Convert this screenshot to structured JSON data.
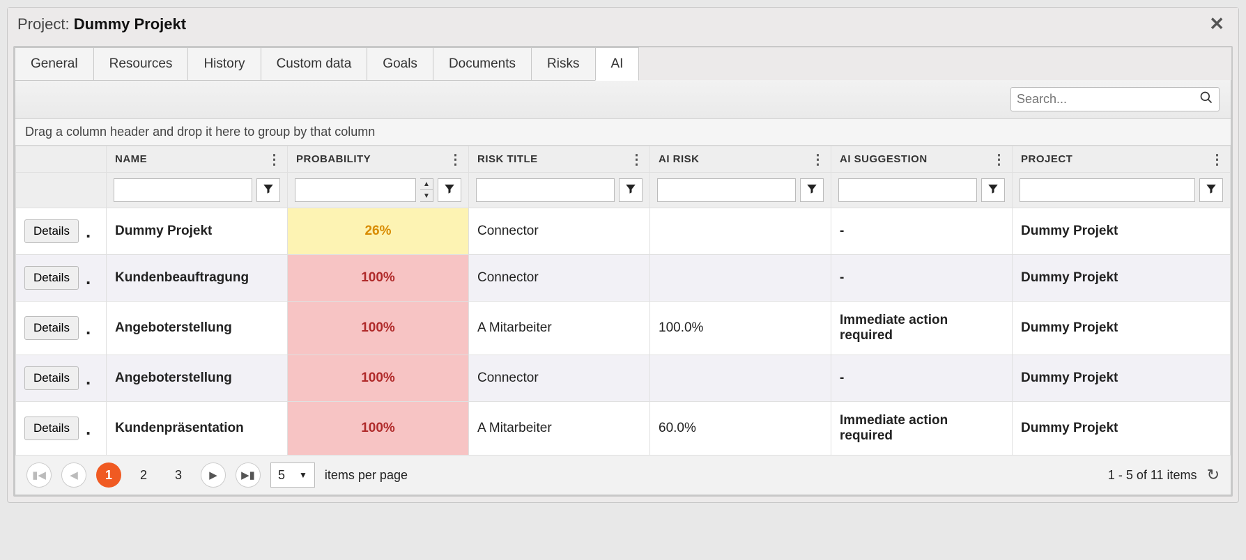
{
  "header": {
    "project_prefix": "Project: ",
    "project_name": "Dummy Projekt",
    "close_glyph": "✕"
  },
  "tabs": [
    {
      "label": "General"
    },
    {
      "label": "Resources"
    },
    {
      "label": "History"
    },
    {
      "label": "Custom data"
    },
    {
      "label": "Goals"
    },
    {
      "label": "Documents"
    },
    {
      "label": "Risks"
    },
    {
      "label": "AI",
      "active": true
    }
  ],
  "search": {
    "placeholder": "Search..."
  },
  "group_hint": "Drag a column header and drop it here to group by that column",
  "columns": [
    {
      "label": ""
    },
    {
      "label": "NAME"
    },
    {
      "label": "PROBABILITY"
    },
    {
      "label": "RISK TITLE"
    },
    {
      "label": "AI RISK"
    },
    {
      "label": "AI SUGGESTION"
    },
    {
      "label": "PROJECT"
    }
  ],
  "details_label": "Details",
  "rows": [
    {
      "name": "Dummy Projekt",
      "probability": "26%",
      "prob_style": "warn",
      "risk_title": "Connector",
      "ai_risk": "",
      "ai_suggestion": "-",
      "project": "Dummy Projekt"
    },
    {
      "name": "Kundenbeauftragung",
      "probability": "100%",
      "prob_style": "danger",
      "risk_title": "Connector",
      "ai_risk": "",
      "ai_suggestion": "-",
      "project": "Dummy Projekt"
    },
    {
      "name": "Angeboterstellung",
      "probability": "100%",
      "prob_style": "danger",
      "risk_title": "A Mitarbeiter",
      "ai_risk": "100.0%",
      "ai_suggestion": "Immediate action required",
      "project": "Dummy Projekt"
    },
    {
      "name": "Angeboterstellung",
      "probability": "100%",
      "prob_style": "danger",
      "risk_title": "Connector",
      "ai_risk": "",
      "ai_suggestion": "-",
      "project": "Dummy Projekt"
    },
    {
      "name": "Kundenpräsentation",
      "probability": "100%",
      "prob_style": "danger",
      "risk_title": "A Mitarbeiter",
      "ai_risk": "60.0%",
      "ai_suggestion": "Immediate action required",
      "project": "Dummy Projekt"
    }
  ],
  "pager": {
    "pages": [
      "1",
      "2",
      "3"
    ],
    "current": "1",
    "page_size": "5",
    "items_per_page_label": "items per page",
    "range": "1 - 5 of 11 items"
  }
}
